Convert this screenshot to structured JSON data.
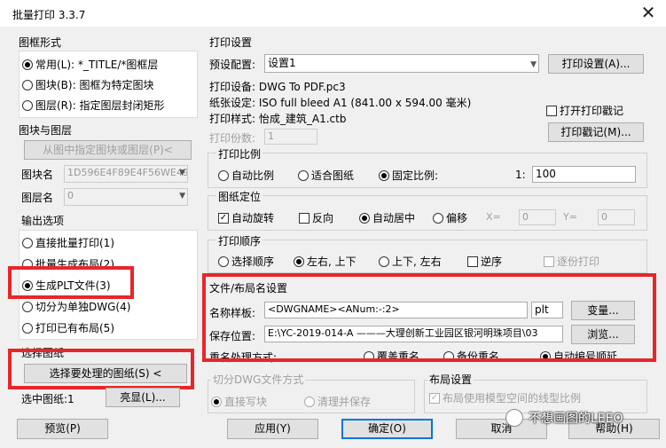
{
  "window": {
    "title": "批量打印 3.3.7"
  },
  "left": {
    "frame_style": {
      "title": "图框形式",
      "options": [
        {
          "label": "常用(L): *_TITLE/*图框层",
          "selected": true
        },
        {
          "label": "图块(B): 图框为特定图块",
          "selected": false
        },
        {
          "label": "图层(R): 指定图层封闭矩形",
          "selected": false
        }
      ]
    },
    "block_layer": {
      "title": "图块与图层",
      "pick_button": "从图中指定图块或图层(P)<",
      "block_label": "图块名",
      "block_value": "1D596E4F89E4F56WE49I",
      "layer_label": "图层名",
      "layer_value": "0"
    },
    "output": {
      "title": "输出选项",
      "options": [
        {
          "label": "直接批量打印(1)",
          "selected": false
        },
        {
          "label": "批量生成布局(2)",
          "selected": false
        },
        {
          "label": "生成PLT文件(3)",
          "selected": true
        },
        {
          "label": "切分为单独DWG(4)",
          "selected": false
        },
        {
          "label": "打印已有布局(5)",
          "selected": false
        }
      ]
    },
    "select": {
      "title": "选择图纸",
      "select_button": "选择要处理的图纸(S) <",
      "selected_label": "选中图纸:1",
      "highlight_button": "亮显(L)..."
    }
  },
  "print_settings": {
    "title": "打印设置",
    "preset_label": "预设配置:",
    "preset_value": "设置1",
    "print_setup_button": "打印设置(A)...",
    "device_line": "打印设备: DWG To PDF.pc3",
    "paper_line": "纸张设定: ISO full bleed A1 (841.00 x 594.00 毫米)",
    "style_line": "打印样式: 怡成_建筑_A1.ctb",
    "open_stamp_label": "打开打印戳记",
    "stamp_button": "打印戳记(M)...",
    "copies_label": "打印份数:",
    "copies_value": "1"
  },
  "scale": {
    "title": "打印比例",
    "options": [
      {
        "label": "自动比例",
        "selected": false
      },
      {
        "label": "适合图纸",
        "selected": false
      },
      {
        "label": "固定比例:",
        "selected": true
      }
    ],
    "ratio_prefix": "1:",
    "ratio_value": "100"
  },
  "position": {
    "title": "图纸定位",
    "auto_rotate": "自动旋转",
    "reverse": "反向",
    "auto_center": "自动居中",
    "offset": "偏移",
    "x_label": "X=",
    "x_value": "0",
    "y_label": "Y=",
    "y_value": "0"
  },
  "order": {
    "title": "打印顺序",
    "options": [
      {
        "label": "选择顺序",
        "selected": false
      },
      {
        "label": "左右, 上下",
        "selected": true
      },
      {
        "label": "上下, 左右",
        "selected": false
      }
    ],
    "reverse": "逆序",
    "per_copy": "逐份打印"
  },
  "file_naming": {
    "title": "文件/布局名设置",
    "name_label": "名称样板:",
    "name_value": "<DWGNAME><ANum:-:2>",
    "ext_value": "plt",
    "variable_button": "变量...",
    "path_label": "保存位置:",
    "path_value": "E:\\YC-2019-014-A  ———大理创新工业园区银河明珠项目\\03",
    "browse_button": "浏览...",
    "dup_label": "重名处理方式:",
    "dup_options": [
      {
        "label": "覆盖重名",
        "selected": false
      },
      {
        "label": "备份重名",
        "selected": false
      },
      {
        "label": "自动编号顺延",
        "selected": true
      }
    ]
  },
  "split": {
    "title": "切分DWG文件方式",
    "options": [
      {
        "label": "直接写块",
        "selected": true
      },
      {
        "label": "清理并保存",
        "selected": false
      }
    ]
  },
  "layout": {
    "title": "布局设置",
    "model_linetype": "布局使用模型空间的线型比例"
  },
  "footer": {
    "preview": "预览(P)",
    "apply": "应用(Y)",
    "ok": "确定(O)",
    "cancel": "取消",
    "help": "帮助(H)"
  },
  "watermark": {
    "text": "不想画图的LEEO"
  },
  "colors": {
    "highlight_red": "#e8262a",
    "primary_blue": "#0078d7"
  }
}
